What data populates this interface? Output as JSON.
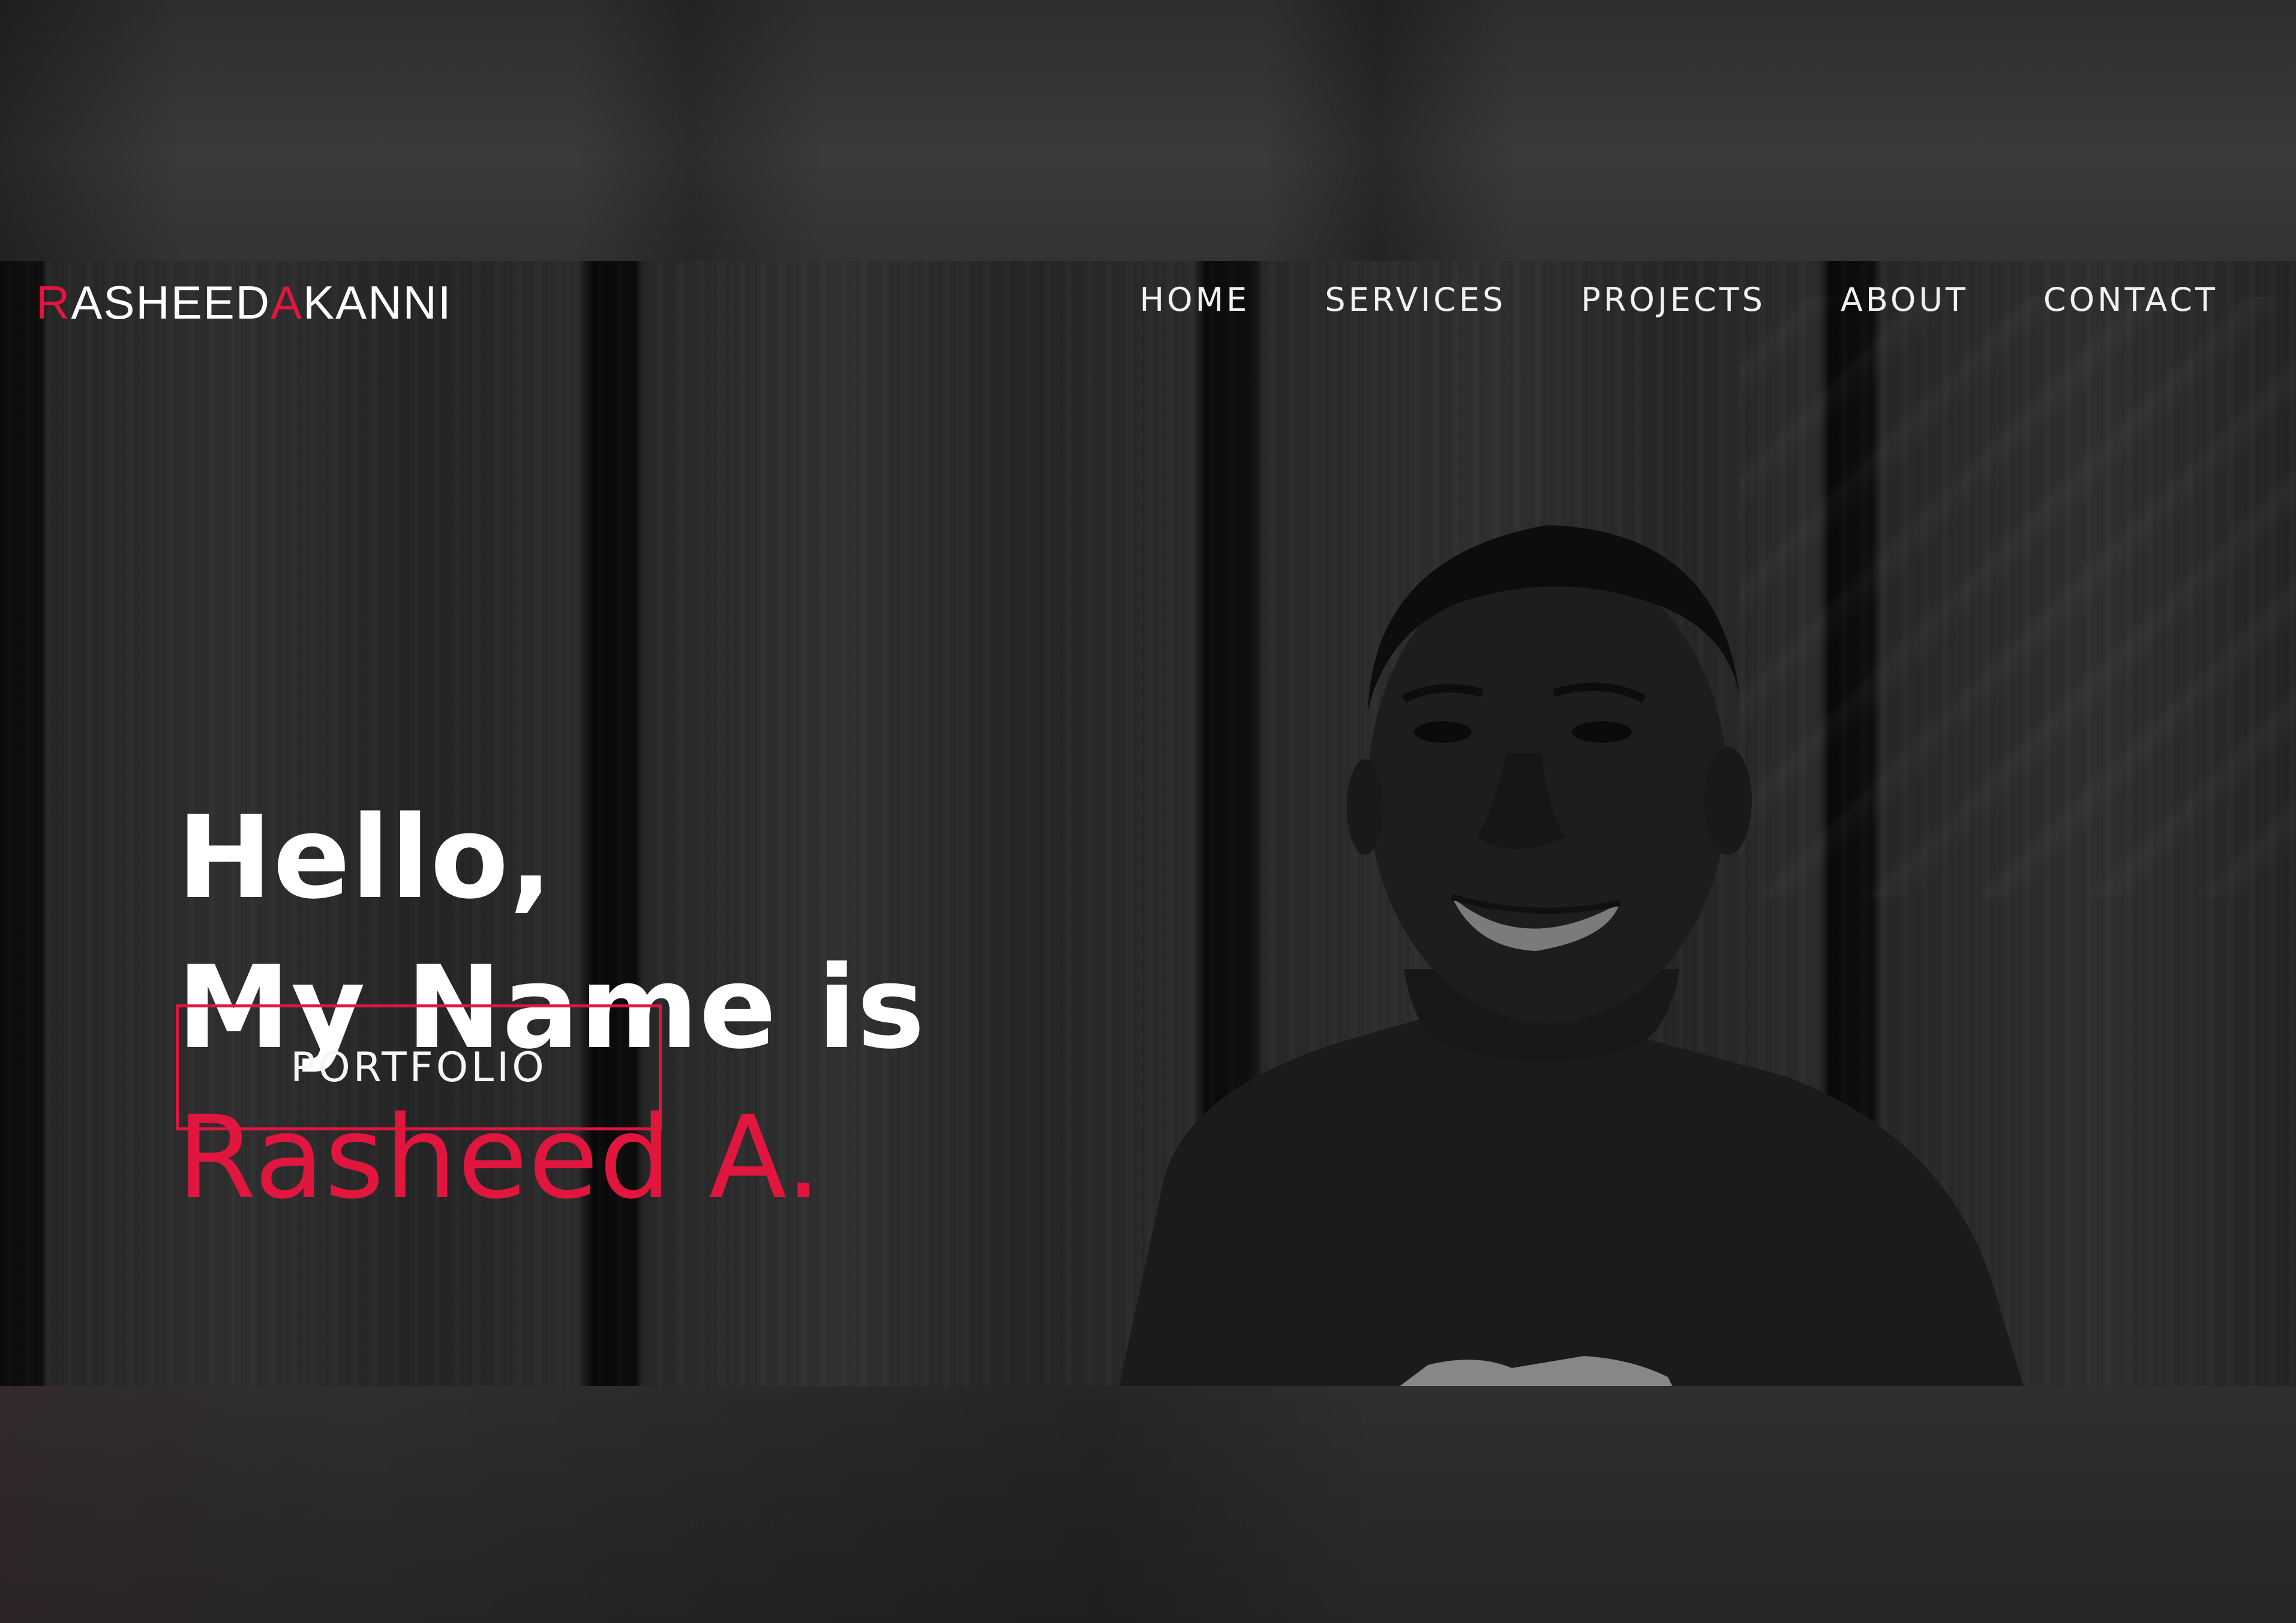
{
  "site": {
    "logo_r": "R",
    "logo_rasheed": "ASHEED",
    "logo_a": "A",
    "logo_kanni": "KANNI"
  },
  "nav": {
    "items": [
      {
        "label": "HOME"
      },
      {
        "label": "SERVICES"
      },
      {
        "label": "PROJECTS"
      },
      {
        "label": "ABOUT"
      },
      {
        "label": "CONTACT"
      }
    ]
  },
  "hero": {
    "line1": "Hello,",
    "line2": "My Name is",
    "name": "Rasheed A.",
    "button_label": "PORTFOLIO"
  },
  "colors": {
    "accent": "#e0163f",
    "text": "#ffffff",
    "background": "#2b2b2b"
  },
  "icons": {
    "portrait": "portrait-photo"
  }
}
